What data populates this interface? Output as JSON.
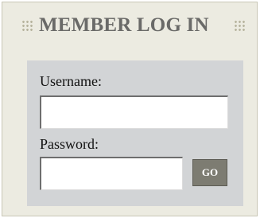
{
  "login": {
    "title": "MEMBER LOG IN",
    "username_label": "Username:",
    "username_value": "",
    "password_label": "Password:",
    "password_value": "",
    "submit_label": "GO"
  }
}
